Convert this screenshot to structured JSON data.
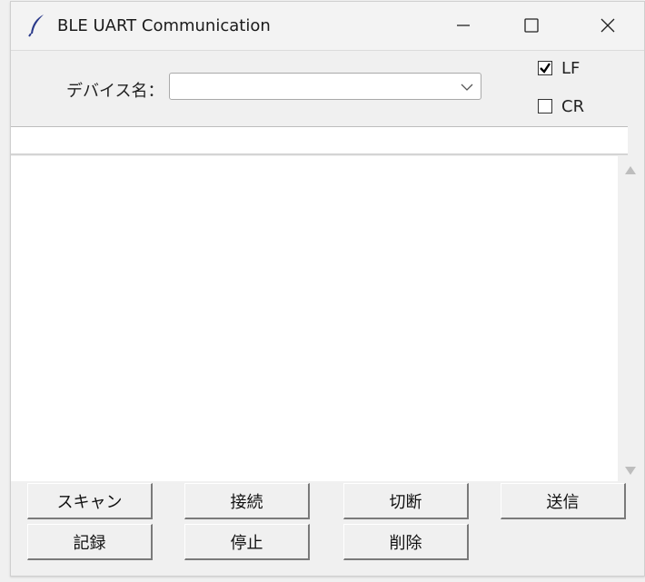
{
  "window": {
    "title": "BLE UART Communication",
    "icon": "feather-icon"
  },
  "controls": {
    "device_label": "デバイス名：",
    "device_value": "",
    "checkboxes": [
      {
        "label": "LF",
        "checked": true
      },
      {
        "label": "CR",
        "checked": false
      }
    ]
  },
  "entry": {
    "value": ""
  },
  "textarea": {
    "value": ""
  },
  "buttons": {
    "scan": "スキャン",
    "connect": "接続",
    "disconnect": "切断",
    "send": "送信",
    "record": "記録",
    "stop": "停止",
    "delete": "削除"
  },
  "colors": {
    "window_bg": "#f0f0f0",
    "field_bg": "#ffffff",
    "text": "#222222"
  }
}
